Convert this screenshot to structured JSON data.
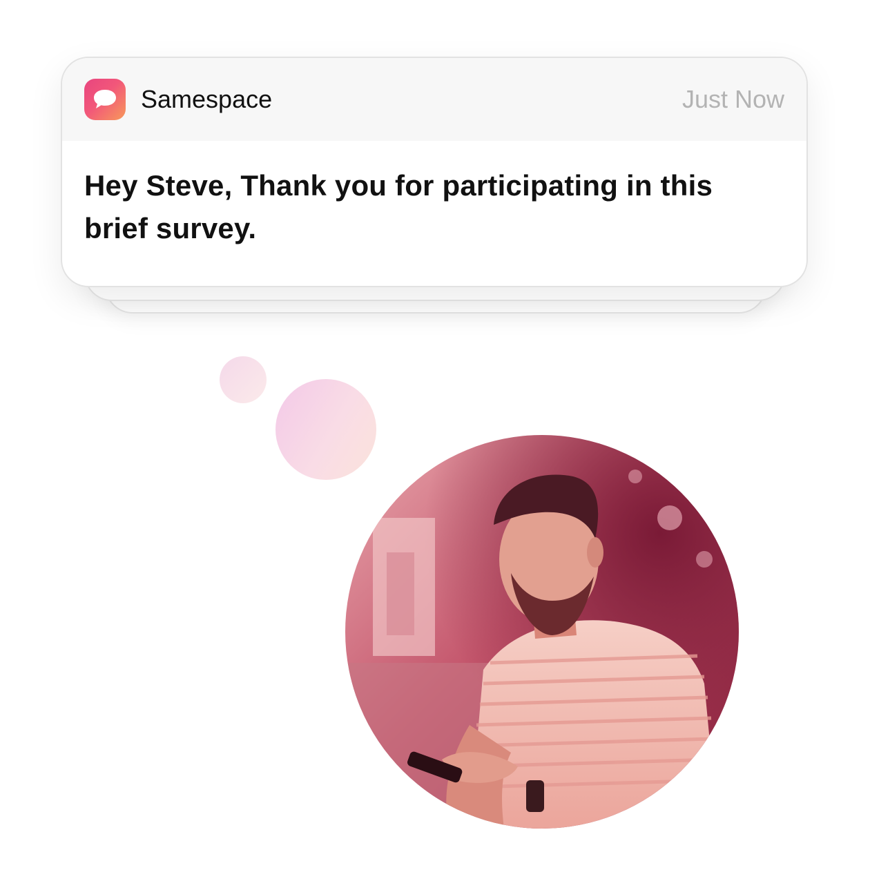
{
  "notification": {
    "app_name": "Samespace",
    "app_icon": "chat-bubble-icon",
    "timestamp": "Just Now",
    "message": "Hey Steve, Thank you for participating in this brief survey."
  },
  "photo": {
    "subject": "man-looking-at-phone-photo",
    "tint_color": "#c8325a"
  },
  "colors": {
    "icon_gradient_start": "#e8457f",
    "icon_gradient_end": "#f7995a",
    "timestamp": "#b3b3b3"
  }
}
